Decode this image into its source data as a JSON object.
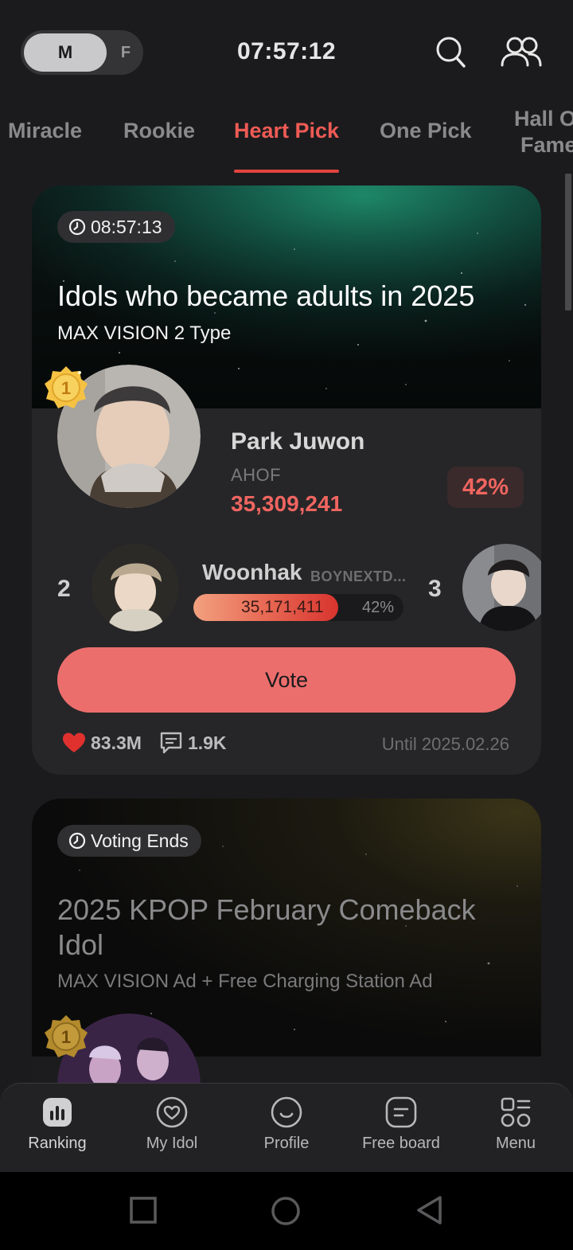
{
  "header": {
    "gender_options": [
      "M",
      "F"
    ],
    "selected_gender": "M",
    "clock": "07:57:12",
    "icons": [
      "search-icon",
      "users-icon"
    ]
  },
  "tabs": [
    {
      "label": "Miracle",
      "active": false
    },
    {
      "label": "Rookie",
      "active": false
    },
    {
      "label": "Heart Pick",
      "active": true
    },
    {
      "label": "One Pick",
      "active": false
    },
    {
      "label": "Hall Of Fame",
      "active": false
    }
  ],
  "tab_hof_lines": [
    "Hall O",
    "Fame"
  ],
  "accent_color": "#ee5b55",
  "card1": {
    "timer": "08:57:13",
    "title": "Idols who became adults in 2025",
    "subtitle": "MAX VISION 2 Type",
    "first": {
      "rank": "1",
      "name": "Park Juwon",
      "group": "AHOF",
      "votes": "35,309,241",
      "percent": "42%"
    },
    "second": {
      "rank": "2",
      "name": "Woonhak",
      "group": "BOYNEXTD...",
      "votes": "35,171,411",
      "percent": "42%",
      "bar_fill_fraction": 0.69
    },
    "third": {
      "rank": "3"
    },
    "vote_label": "Vote",
    "hearts": "83.3M",
    "comments": "1.9K",
    "until": "Until 2025.02.26"
  },
  "card2": {
    "timer": "Voting Ends",
    "title": "2025 KPOP February Comeback Idol",
    "subtitle": "MAX VISION Ad + Free Charging Station Ad",
    "first_rank": "1"
  },
  "bottom_nav": [
    {
      "label": "Ranking",
      "icon": "chart-icon",
      "active": true
    },
    {
      "label": "My Idol",
      "icon": "heart-icon",
      "active": false
    },
    {
      "label": "Profile",
      "icon": "smile-icon",
      "active": false
    },
    {
      "label": "Free board",
      "icon": "board-icon",
      "active": false
    },
    {
      "label": "Menu",
      "icon": "menu-grid-icon",
      "active": false
    }
  ]
}
